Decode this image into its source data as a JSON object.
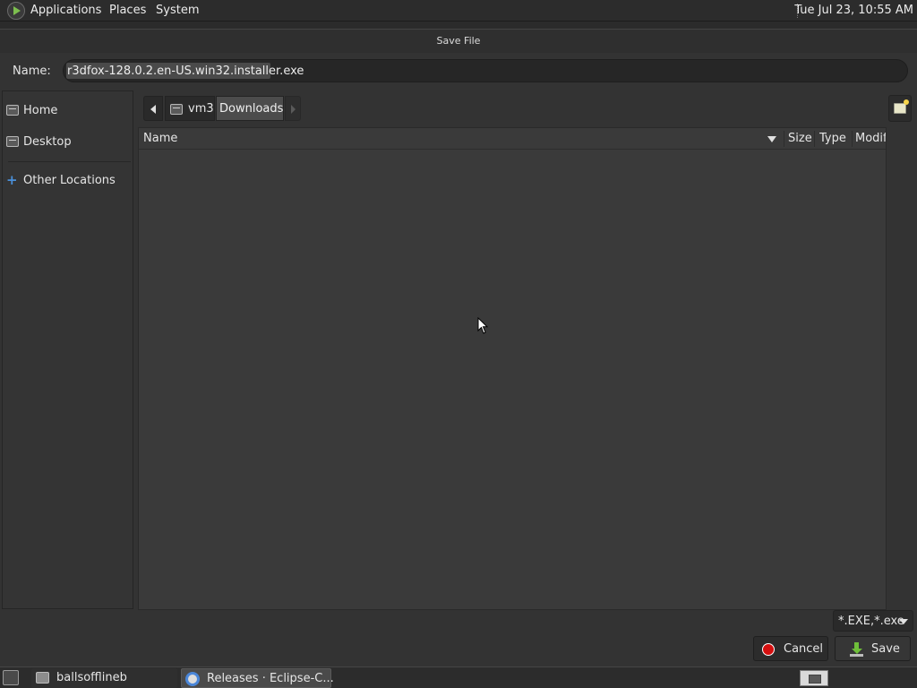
{
  "top_panel": {
    "menus": [
      "Applications",
      "Places",
      "System"
    ],
    "clock": "Tue Jul 23, 10:55 AM"
  },
  "dialog": {
    "title": "Save File",
    "name_label": "Name:",
    "name_value": "r3dfox-128.0.2.en-US.win32.installer.exe",
    "sidebar": {
      "items": [
        {
          "label": "Home",
          "icon": "home-folder-icon"
        },
        {
          "label": "Desktop",
          "icon": "desktop-folder-icon"
        },
        {
          "label": "Other Locations",
          "icon": "plus-icon"
        }
      ]
    },
    "pathbar": {
      "segments": [
        "vm3",
        "Downloads"
      ]
    },
    "columns": [
      "Name",
      "Size",
      "Type",
      "Modif"
    ],
    "filter": "*.EXE,*.exe",
    "buttons": {
      "cancel": "Cancel",
      "save": "Save"
    }
  },
  "taskbar": {
    "items": [
      {
        "label": "ballsofflineb",
        "icon": "folder-icon"
      },
      {
        "label": "Releases · Eclipse-C...",
        "icon": "chromium-icon"
      }
    ]
  },
  "colors": {
    "panel_bg": "#2c2c2c",
    "window_bg": "#333333",
    "content_bg": "#3a3a3a",
    "accent_blue": "#4a90d9",
    "cancel_red": "#d40f0f",
    "save_green": "#6fbf3a"
  }
}
